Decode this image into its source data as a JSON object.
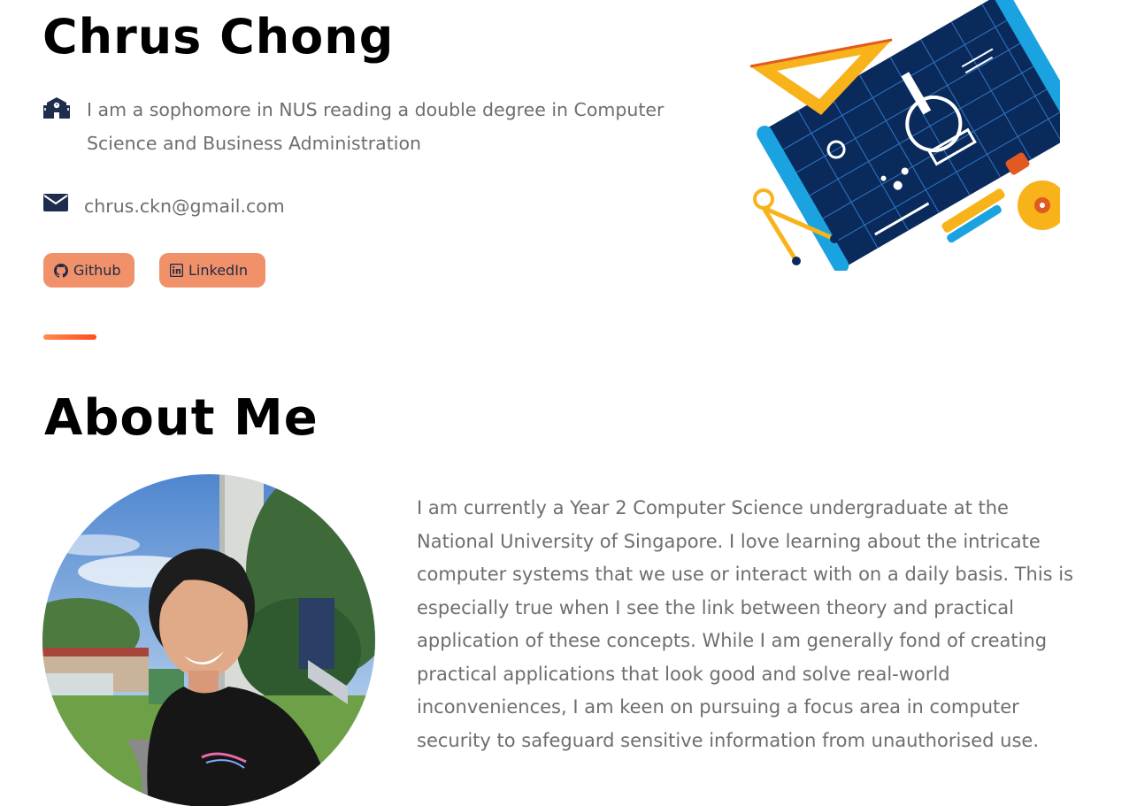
{
  "header": {
    "name": "Chrus Chong",
    "school_text": "I am a sophomore in NUS reading a double degree in Computer Science and Business Administration",
    "email": "chrus.ckn@gmail.com"
  },
  "links": {
    "github_label": "Github",
    "linkedin_label": "LinkedIn"
  },
  "icons": {
    "school": "school-icon",
    "email": "envelope-icon",
    "github": "github-icon",
    "linkedin": "linkedin-icon"
  },
  "about": {
    "title": "About Me",
    "text": "I am currently a Year 2 Computer Science undergraduate at the National University of Singapore. I love learning about the intricate computer systems that we use or interact with on a daily basis. This is especially true when I see the link between theory and practical application of these concepts. While I am generally fond of creating practical applications that look good and solve real-world inconveniences, I am keen on pursuing a focus area in computer security to safeguard sensitive information from unauthorised use."
  },
  "colors": {
    "button": "#f0916a",
    "accent_gradient_start": "#ff8a4c",
    "accent_gradient_end": "#ff4d1f",
    "icon": "#1f2d4d"
  }
}
